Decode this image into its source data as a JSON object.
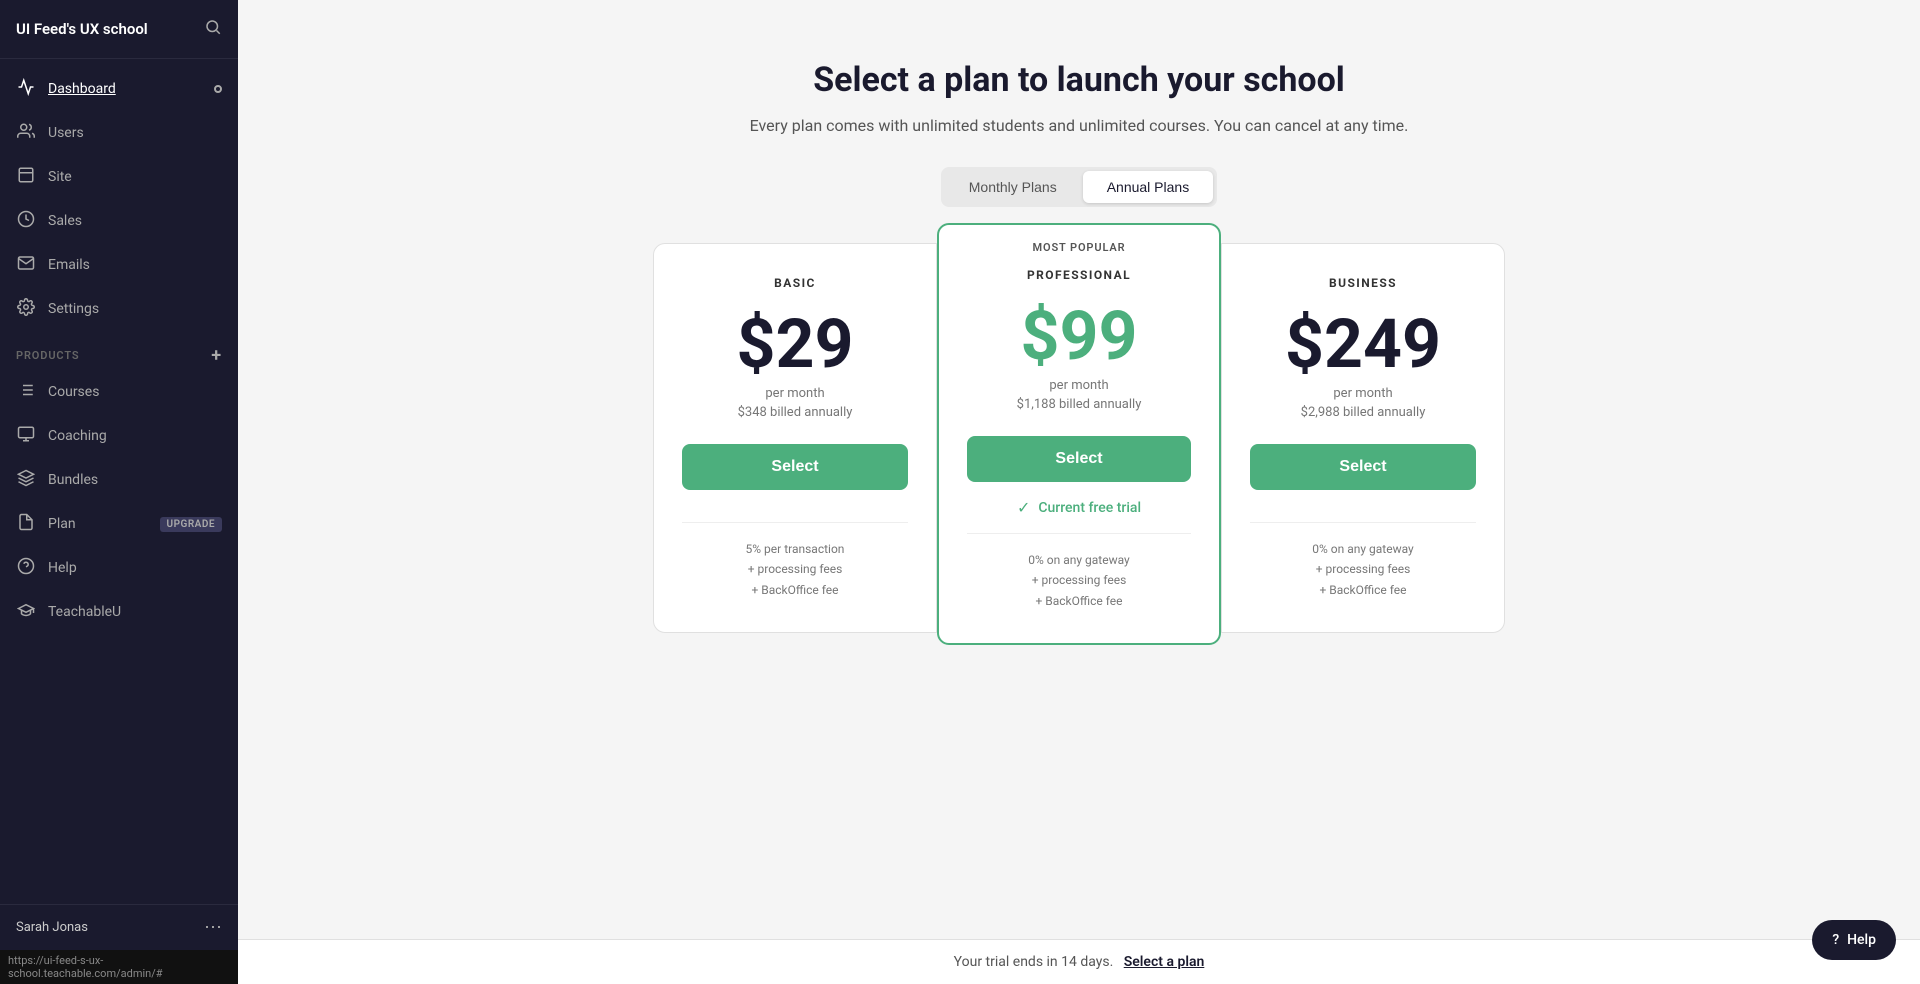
{
  "app": {
    "title": "UI Feed's UX school",
    "url": "https://ui-feed-s-ux-school.teachable.com/admin/#"
  },
  "sidebar": {
    "main_nav": [
      {
        "id": "dashboard",
        "label": "Dashboard",
        "icon": "chart-icon",
        "active": true,
        "badge": true
      },
      {
        "id": "users",
        "label": "Users",
        "icon": "users-icon",
        "active": false
      },
      {
        "id": "site",
        "label": "Site",
        "icon": "site-icon",
        "active": false
      },
      {
        "id": "sales",
        "label": "Sales",
        "icon": "sales-icon",
        "active": false
      },
      {
        "id": "emails",
        "label": "Emails",
        "icon": "emails-icon",
        "active": false
      },
      {
        "id": "settings",
        "label": "Settings",
        "icon": "settings-icon",
        "active": false
      }
    ],
    "products_section": "PRODUCTS",
    "products_nav": [
      {
        "id": "courses",
        "label": "Courses",
        "icon": "courses-icon"
      },
      {
        "id": "coaching",
        "label": "Coaching",
        "icon": "coaching-icon"
      },
      {
        "id": "bundles",
        "label": "Bundles",
        "icon": "bundles-icon"
      }
    ],
    "bottom_nav": [
      {
        "id": "plan",
        "label": "Plan",
        "icon": "plan-icon",
        "badge": "UPGRADE"
      },
      {
        "id": "help",
        "label": "Help",
        "icon": "help-icon"
      },
      {
        "id": "teachableu",
        "label": "TeachableU",
        "icon": "teachableu-icon"
      }
    ],
    "user": {
      "name": "Sarah Jonas",
      "menu_icon": "ellipsis-icon"
    }
  },
  "pricing": {
    "title": "Select a plan to launch your school",
    "subtitle": "Every plan comes with unlimited students and unlimited courses. You can cancel at any time.",
    "billing_tabs": [
      {
        "id": "monthly",
        "label": "Monthly Plans",
        "active": false
      },
      {
        "id": "annual",
        "label": "Annual Plans",
        "active": true
      }
    ],
    "plans": [
      {
        "id": "basic",
        "name": "BASIC",
        "price": "$29",
        "billing": "per month",
        "annual": "$348 billed annually",
        "select_label": "Select",
        "current_trial": false,
        "fee_line1": "5% per transaction",
        "fee_line2": "+ processing fees",
        "fee_line3": "+ BackOffice fee"
      },
      {
        "id": "professional",
        "name": "PROFESSIONAL",
        "most_popular": "MOST POPULAR",
        "price": "$99",
        "billing": "per month",
        "annual": "$1,188 billed annually",
        "select_label": "Select",
        "current_trial": true,
        "current_trial_label": "Current free trial",
        "fee_line1": "0% on any gateway",
        "fee_line2": "+ processing fees",
        "fee_line3": "+ BackOffice fee"
      },
      {
        "id": "business",
        "name": "BUSINESS",
        "price": "$249",
        "billing": "per month",
        "annual": "$2,988 billed annually",
        "select_label": "Select",
        "current_trial": false,
        "fee_line1": "0% on any gateway",
        "fee_line2": "+ processing fees",
        "fee_line3": "+ BackOffice fee"
      }
    ]
  },
  "trial_bar": {
    "text": "Your trial ends in 14 days.",
    "link_text": "Select a plan"
  },
  "help_button": {
    "label": "Help",
    "icon": "help-circle-icon"
  },
  "colors": {
    "green": "#4caf7d",
    "dark": "#1a1a2e",
    "sidebar_bg": "#1a1a2e"
  }
}
